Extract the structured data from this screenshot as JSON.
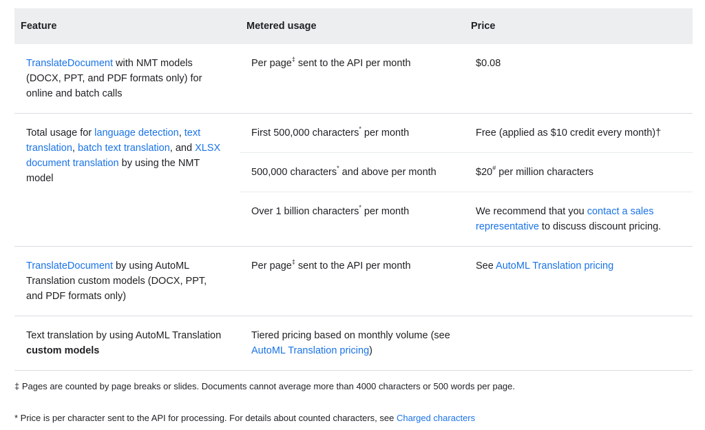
{
  "headers": {
    "feature": "Feature",
    "usage": "Metered usage",
    "price": "Price"
  },
  "row1": {
    "feature_link": "TranslateDocument",
    "feature_rest": " with NMT models (DOCX, PPT, and PDF formats only) for online and batch calls",
    "usage_pre": "Per page",
    "usage_sup": "‡",
    "usage_post": " sent to the API per month",
    "price": "$0.08"
  },
  "row2": {
    "feature_pre": "Total usage for ",
    "link_lang": "language detection",
    "sep1": ", ",
    "link_text": "text translation",
    "sep2": ", ",
    "link_batch": "batch text translation",
    "sep3": ", and ",
    "link_xlsx": "XLSX document translation",
    "feature_post": " by using the NMT model",
    "tiers": [
      {
        "usage_pre": "First 500,000 characters",
        "usage_sup": "*",
        "usage_post": " per month",
        "price": "Free (applied as $10 credit every month)†"
      },
      {
        "usage_pre": "500,000 characters",
        "usage_sup": "*",
        "usage_post": " and above per month",
        "price_pre": "$20",
        "price_sup": "#",
        "price_post": " per million characters"
      },
      {
        "usage_pre": "Over 1 billion characters",
        "usage_sup": "*",
        "usage_post": " per month",
        "price_pre": "We recommend that you ",
        "price_link": "contact a sales representative",
        "price_post": " to discuss discount pricing."
      }
    ]
  },
  "row3": {
    "feature_link": "TranslateDocument",
    "feature_rest": " by using AutoML Translation custom models (DOCX, PPT, and PDF formats only)",
    "usage_pre": "Per page",
    "usage_sup": "‡",
    "usage_post": " sent to the API per month",
    "price_pre": "See ",
    "price_link": "AutoML Translation pricing"
  },
  "row4": {
    "feature_pre": "Text translation by using AutoML Translation ",
    "feature_bold": "custom models",
    "usage_pre": "Tiered pricing based on monthly volume (see ",
    "usage_link": "AutoML Translation pricing",
    "usage_post": ")"
  },
  "notes": {
    "n1": "‡ Pages are counted by page breaks or slides. Documents cannot average more than 4000 characters or 500 words per page.",
    "n2_pre": "* Price is per character sent to the API for processing. For details about counted characters, see ",
    "n2_link": "Charged characters"
  },
  "colors": {
    "link": "#1a73e8",
    "header_bg": "#eceef0",
    "text": "#202124"
  }
}
